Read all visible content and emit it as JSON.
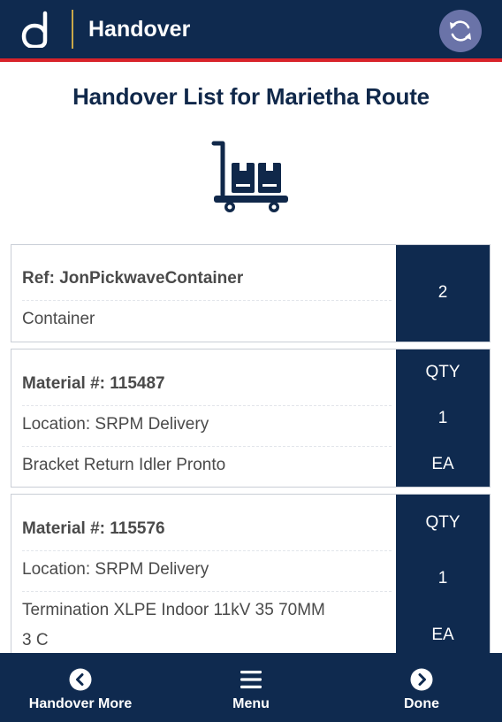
{
  "header": {
    "title": "Handover",
    "sync_icon": "sync-icon",
    "logo_icon": "app-logo",
    "colors": {
      "bar": "#0f2a4f",
      "stripe": "#d8232a",
      "divider": "#c9a74a",
      "sync_button": "#6a73a8"
    }
  },
  "page": {
    "title": "Handover List for Marietha Route",
    "hero_icon": "cart-icon"
  },
  "cards": [
    {
      "lines": [
        "Ref: JonPickwaveContainer",
        "Container"
      ],
      "right": [
        "2"
      ]
    },
    {
      "lines": [
        "Material #: 115487",
        "Location: SRPM Delivery",
        "Bracket Return Idler Pronto"
      ],
      "right": [
        "QTY",
        "1",
        "EA"
      ]
    },
    {
      "lines": [
        "Material #: 115576",
        "Location: SRPM Delivery",
        "Termination XLPE Indoor 11kV 35 70MM",
        "3 C"
      ],
      "right": [
        "QTY",
        "1",
        "EA"
      ]
    }
  ],
  "bottom_nav": [
    {
      "label": "Handover More",
      "icon": "chevron-left-circle-icon"
    },
    {
      "label": "Menu",
      "icon": "menu-icon"
    },
    {
      "label": "Done",
      "icon": "chevron-right-circle-icon"
    }
  ]
}
